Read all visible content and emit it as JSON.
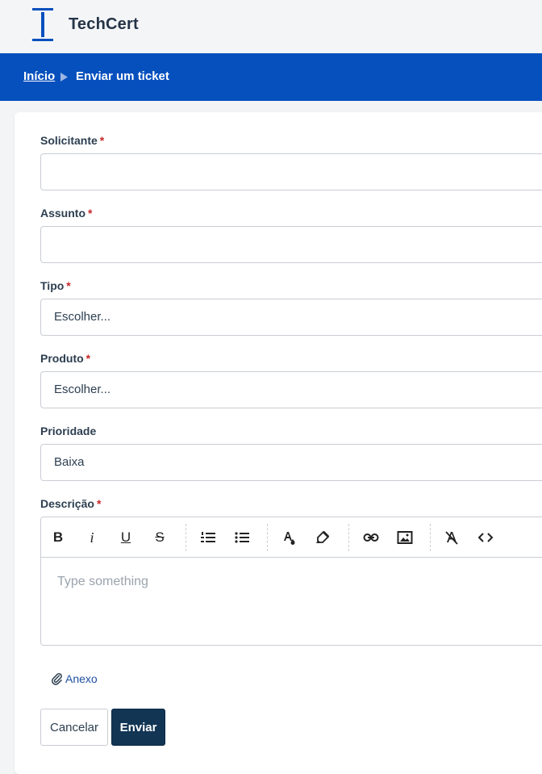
{
  "header": {
    "brand": "TechCert",
    "logo_icon": "t-beam-logo-icon",
    "brand_color": "#0650be"
  },
  "breadcrumb": {
    "home": "Início",
    "current": "Enviar um ticket",
    "separator_icon": "triangle-right-icon"
  },
  "form": {
    "requester": {
      "label": "Solicitante",
      "required_mark": "*",
      "value": ""
    },
    "subject": {
      "label": "Assunto",
      "required_mark": "*",
      "value": ""
    },
    "type": {
      "label": "Tipo",
      "required_mark": "*",
      "selected": "Escolher..."
    },
    "product": {
      "label": "Produto",
      "required_mark": "*",
      "selected": "Escolher..."
    },
    "priority": {
      "label": "Prioridade",
      "selected": "Baixa"
    },
    "description": {
      "label": "Descrição",
      "required_mark": "*",
      "placeholder": "Type something",
      "toolbar": {
        "bold": "B",
        "italic": "i",
        "underline": "U",
        "strike": "S",
        "icons": [
          "bold-icon",
          "italic-icon",
          "underline-icon",
          "strikethrough-icon",
          "ordered-list-icon",
          "bullet-list-icon",
          "text-color-icon",
          "highlight-icon",
          "link-icon",
          "image-icon",
          "clear-format-icon",
          "code-icon"
        ]
      }
    },
    "attachment": {
      "label": "Anexo",
      "icon": "paperclip-icon"
    },
    "buttons": {
      "cancel": "Cancelar",
      "submit": "Enviar"
    }
  },
  "colors": {
    "required": "#c62828",
    "submit_bg": "#123554",
    "link": "#1f4fa0"
  }
}
